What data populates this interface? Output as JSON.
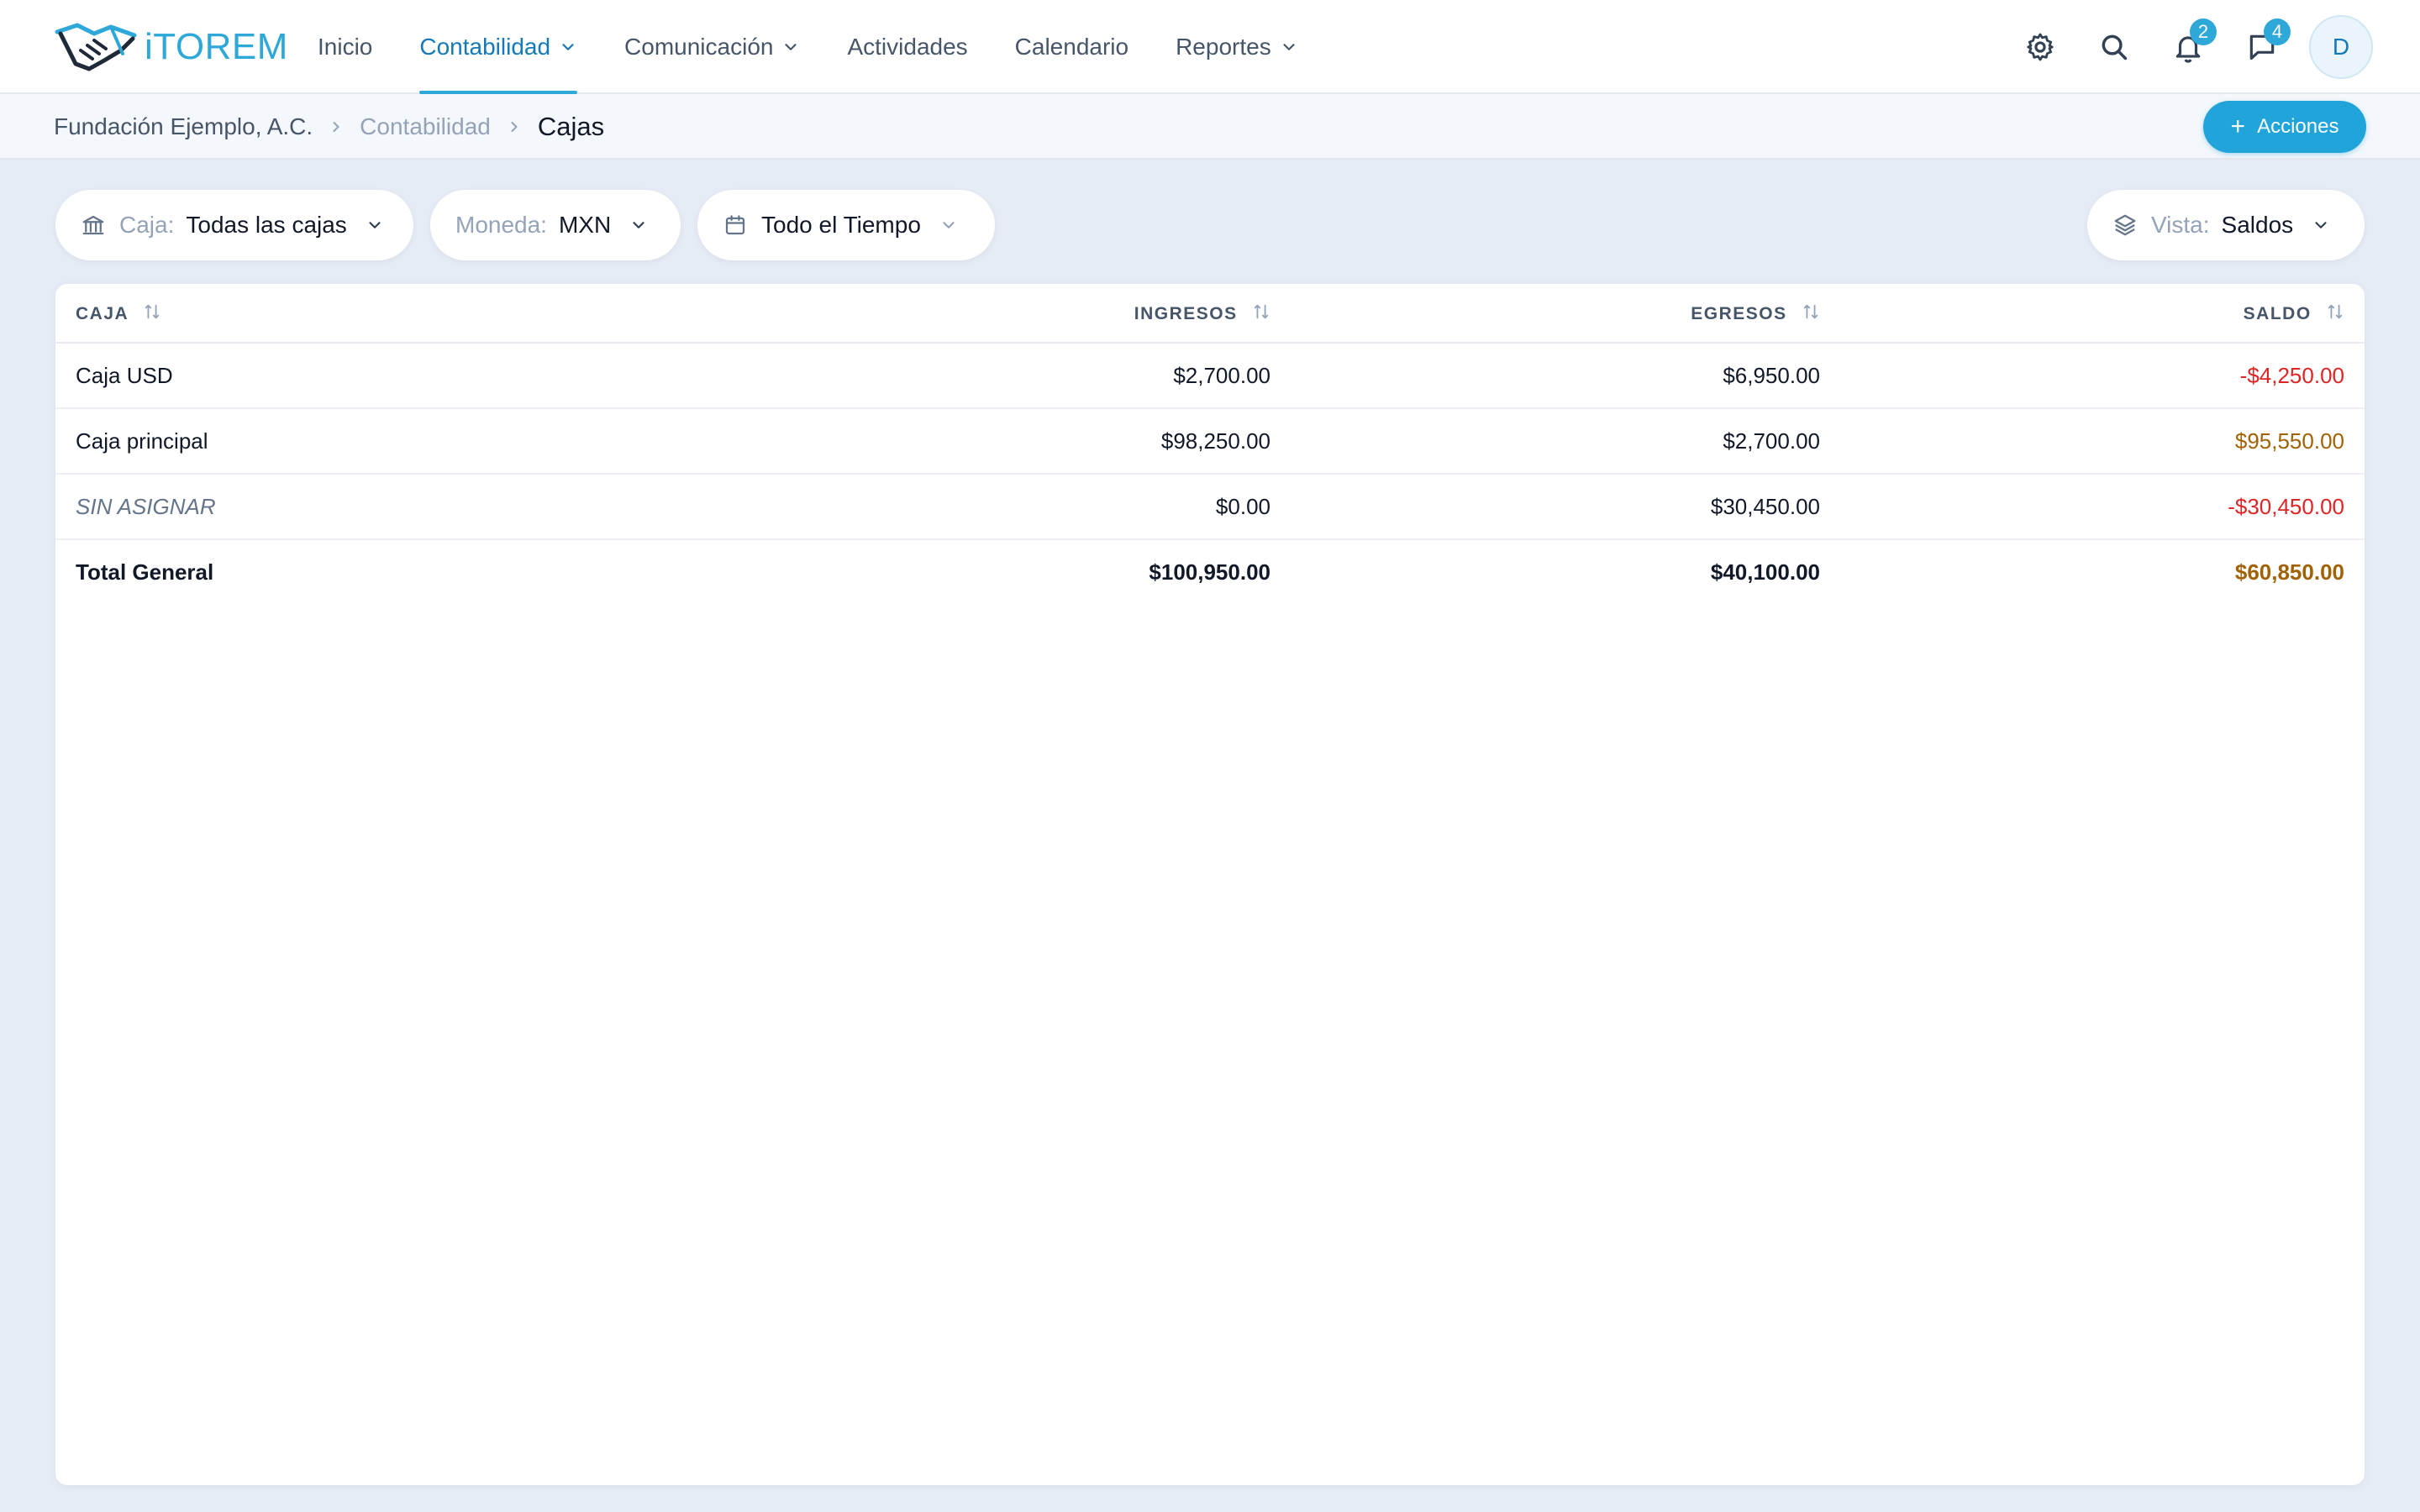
{
  "app": {
    "logo_text": "iTOREM"
  },
  "nav": {
    "items": [
      {
        "label": "Inicio"
      },
      {
        "label": "Contabilidad"
      },
      {
        "label": "Comunicación"
      },
      {
        "label": "Actividades"
      },
      {
        "label": "Calendario"
      },
      {
        "label": "Reportes"
      }
    ],
    "active": "Contabilidad"
  },
  "header": {
    "notifications_count": "2",
    "messages_count": "4",
    "avatar_initial": "D",
    "icons": [
      "gear-icon",
      "search-icon",
      "bell-icon",
      "chat-icon"
    ]
  },
  "breadcrumb": {
    "items": [
      "Fundación Ejemplo, A.C.",
      "Contabilidad",
      "Cajas"
    ]
  },
  "actions": {
    "label": "Acciones"
  },
  "filters": {
    "caja": {
      "label": "Caja:",
      "value": "Todas las cajas"
    },
    "moneda": {
      "label": "Moneda:",
      "value": "MXN"
    },
    "periodo": {
      "value": "Todo el Tiempo"
    },
    "vista": {
      "label": "Vista:",
      "value": "Saldos"
    }
  },
  "table": {
    "columns": [
      "CAJA",
      "INGRESOS",
      "EGRESOS",
      "SALDO"
    ],
    "rows": [
      {
        "caja": "Caja USD",
        "ingresos": "$2,700.00",
        "egresos": "$6,950.00",
        "saldo": "-$4,250.00"
      },
      {
        "caja": "Caja principal",
        "ingresos": "$98,250.00",
        "egresos": "$2,700.00",
        "saldo": "$95,550.00"
      },
      {
        "caja": "SIN ASIGNAR",
        "ingresos": "$0.00",
        "egresos": "$30,450.00",
        "saldo": "-$30,450.00"
      }
    ],
    "total": {
      "caja": "Total General",
      "ingresos": "$100,950.00",
      "egresos": "$40,100.00",
      "saldo": "$60,850.00"
    }
  },
  "colors": {
    "accent": "#2ea8d8",
    "negative": "#dc2626",
    "positive": "#a16207"
  }
}
